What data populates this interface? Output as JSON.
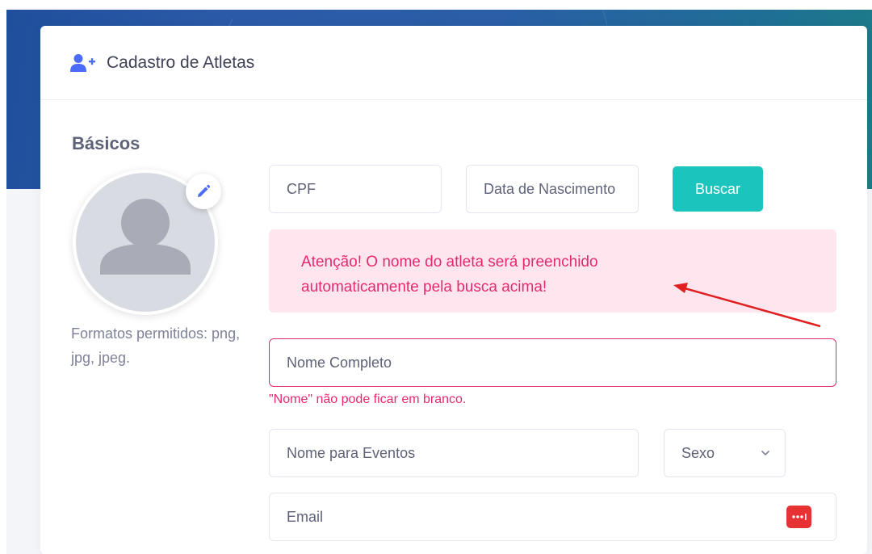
{
  "header": {
    "title": "Cadastro de Atletas",
    "icon": "user-plus-icon",
    "icon_color": "#4a6cf7"
  },
  "section": {
    "title": "Básicos"
  },
  "avatar": {
    "edit_icon": "pencil-icon",
    "formats_text": "Formatos permitidos: png, jpg, jpeg."
  },
  "search": {
    "cpf_placeholder": "CPF",
    "dob_placeholder": "Data de Nascimento",
    "button_label": "Buscar",
    "button_color": "#1bc5bd"
  },
  "alert": {
    "line1": "Atenção! O nome do atleta será preenchido",
    "line2": "automaticamente pela busca acima!",
    "color": "#e6296e",
    "background": "#ffe6ee"
  },
  "form": {
    "name_placeholder": "Nome Completo",
    "name_error": "\"Nome\" não pode ficar em branco.",
    "event_name_placeholder": "Nome para Eventos",
    "sex_label": "Sexo",
    "email_placeholder": "Email",
    "password_manager_icon": "password-manager-icon"
  },
  "annotation": {
    "arrow_color": "#e02020"
  }
}
